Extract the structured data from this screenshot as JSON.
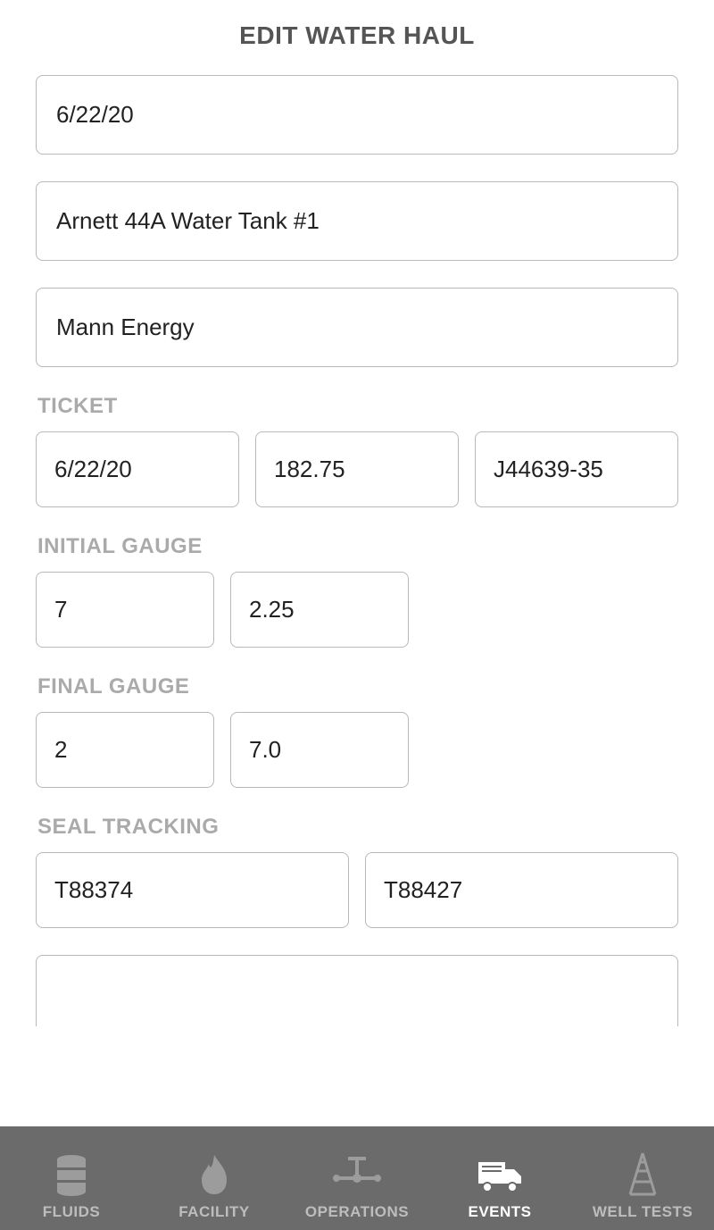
{
  "header": {
    "title": "EDIT WATER HAUL"
  },
  "form": {
    "date": "6/22/20",
    "tank": "Arnett 44A Water Tank #1",
    "company": "Mann Energy",
    "ticket": {
      "label": "TICKET",
      "date": "6/22/20",
      "amount": "182.75",
      "number": "J44639-35"
    },
    "initial_gauge": {
      "label": "INITIAL GAUGE",
      "feet": "7",
      "inches": "2.25"
    },
    "final_gauge": {
      "label": "FINAL GAUGE",
      "feet": "2",
      "inches": "7.0"
    },
    "seal_tracking": {
      "label": "SEAL TRACKING",
      "on": "T88374",
      "off": "T88427"
    }
  },
  "tabs": {
    "items": [
      {
        "label": "FLUIDS"
      },
      {
        "label": "FACILITY"
      },
      {
        "label": "OPERATIONS"
      },
      {
        "label": "EVENTS"
      },
      {
        "label": "WELL TESTS"
      }
    ],
    "active_index": 3
  }
}
